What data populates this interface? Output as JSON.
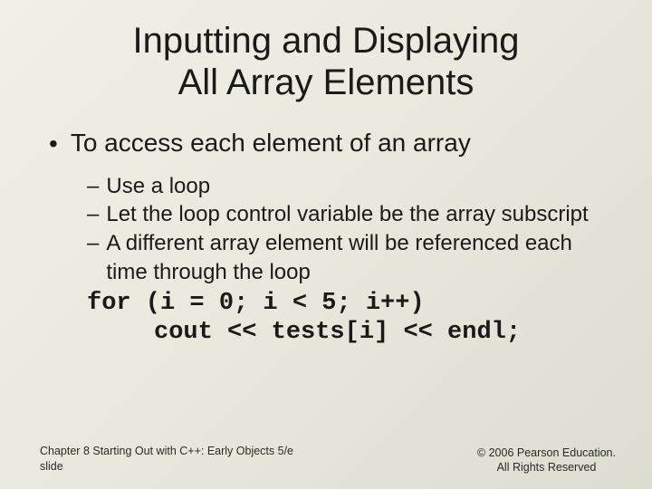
{
  "title_line1": "Inputting and Displaying",
  "title_line2": "All Array Elements",
  "bullet1": "To access each element of an array",
  "sub1": "Use a loop",
  "sub2": "Let the loop control variable be the array subscript",
  "sub3": "A different array element will be referenced each time through the loop",
  "code1": "for (i = 0; i < 5; i++)",
  "code2": "cout << tests[i] << endl;",
  "footer_left_line1": "Chapter 8 Starting Out with C++: Early Objects 5/e",
  "footer_left_line2": "slide",
  "footer_right_line1": "© 2006 Pearson Education.",
  "footer_right_line2": "All Rights Reserved"
}
